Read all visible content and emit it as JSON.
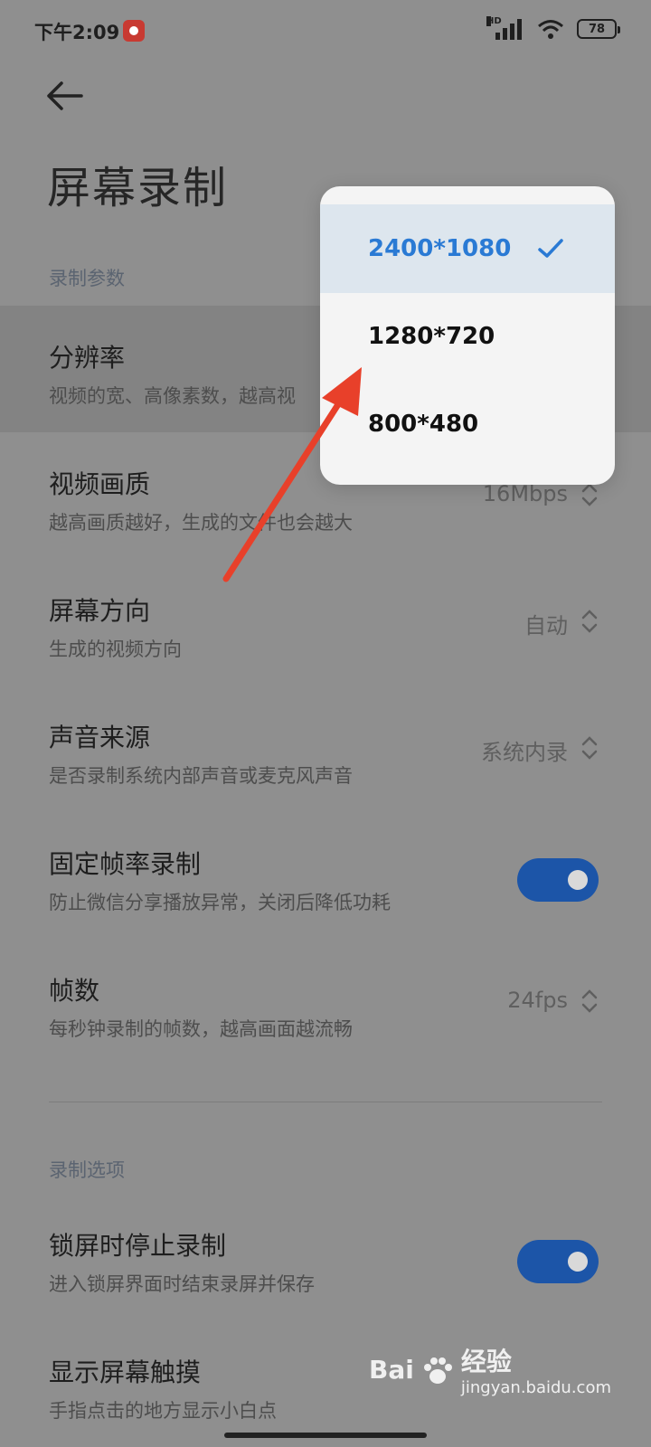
{
  "status_bar": {
    "time": "下午2:09",
    "network": "HD",
    "battery": "78",
    "icons": [
      "app-notification-icon",
      "signal-icon",
      "wifi-icon",
      "battery-icon"
    ]
  },
  "header": {
    "back_icon": "arrow-left-icon",
    "title": "屏幕录制"
  },
  "sections": {
    "params": {
      "title": "录制参数",
      "rows": [
        {
          "title": "分辨率",
          "subtitle": "视频的宽、高像素数，越高视"
        },
        {
          "title": "视频画质",
          "subtitle": "越高画质越好，生成的文件也会越大",
          "value": "16Mbps"
        },
        {
          "title": "屏幕方向",
          "subtitle": "生成的视频方向",
          "value": "自动"
        },
        {
          "title": "声音来源",
          "subtitle": "是否录制系统内部声音或麦克风声音",
          "value": "系统内录"
        },
        {
          "title": "固定帧率录制",
          "subtitle": "防止微信分享播放异常，关闭后降低功耗",
          "toggle": true
        },
        {
          "title": "帧数",
          "subtitle": "每秒钟录制的帧数，越高画面越流畅",
          "value": "24fps"
        }
      ]
    },
    "options": {
      "title": "录制选项",
      "rows": [
        {
          "title": "锁屏时停止录制",
          "subtitle": "进入锁屏界面时结束录屏并保存",
          "toggle": true
        },
        {
          "title": "显示屏幕触摸",
          "subtitle": "手指点击的地方显示小白点"
        }
      ]
    }
  },
  "dropdown": {
    "options": [
      "2400*1080",
      "1280*720",
      "800*480"
    ],
    "selected": "2400*1080",
    "check_icon": "checkmark-icon"
  },
  "annotation": {
    "color": "#e8402a",
    "type": "arrow"
  },
  "watermark": {
    "brand": "Bai",
    "brand_suffix": "经验",
    "domain": "jingyan.baidu.com"
  },
  "colors": {
    "accent": "#2a7ad4",
    "toggle_on": "#1c55a8",
    "dim_background": "#8f8f8f"
  }
}
